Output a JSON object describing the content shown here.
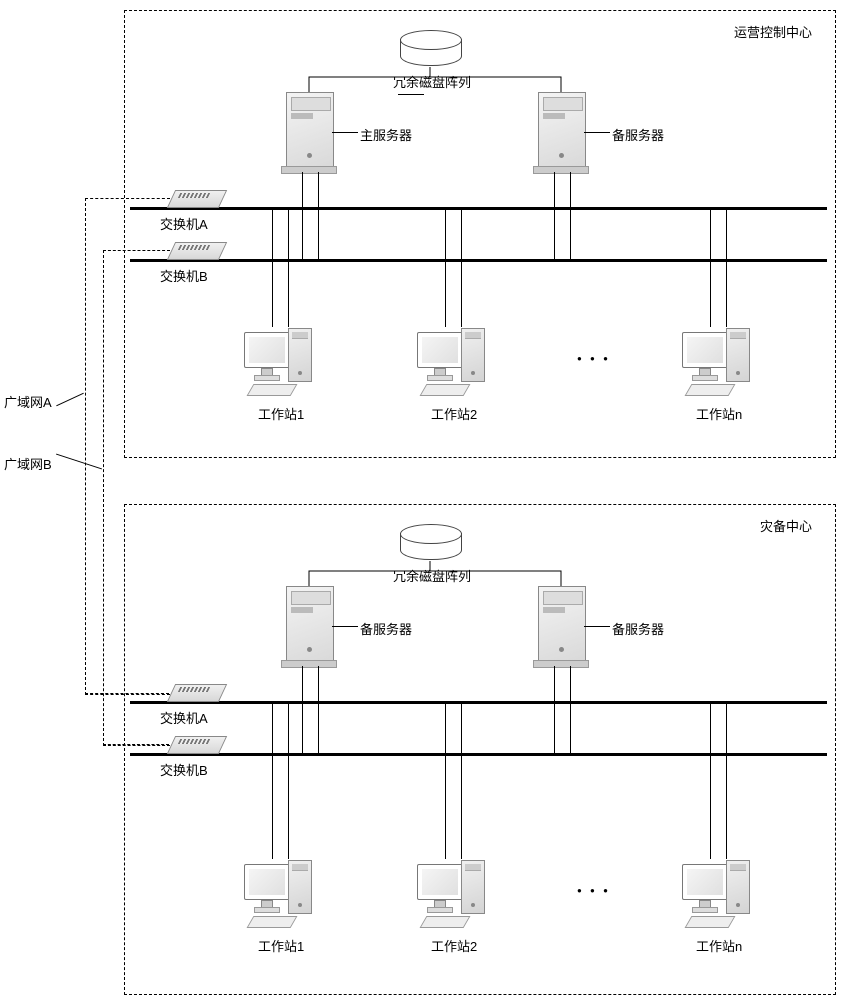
{
  "labels": {
    "occ_title": "运营控制中心",
    "dr_title": "灾备中心",
    "raid": "冗余磁盘阵列",
    "main_server": "主服务器",
    "backup_server": "备服务器",
    "switch_a": "交换机A",
    "switch_b": "交换机B",
    "ws1": "工作站1",
    "ws2": "工作站2",
    "wsn": "工作站n",
    "wan_a": "广域网A",
    "wan_b": "广域网B",
    "dots": "● ● ●"
  }
}
